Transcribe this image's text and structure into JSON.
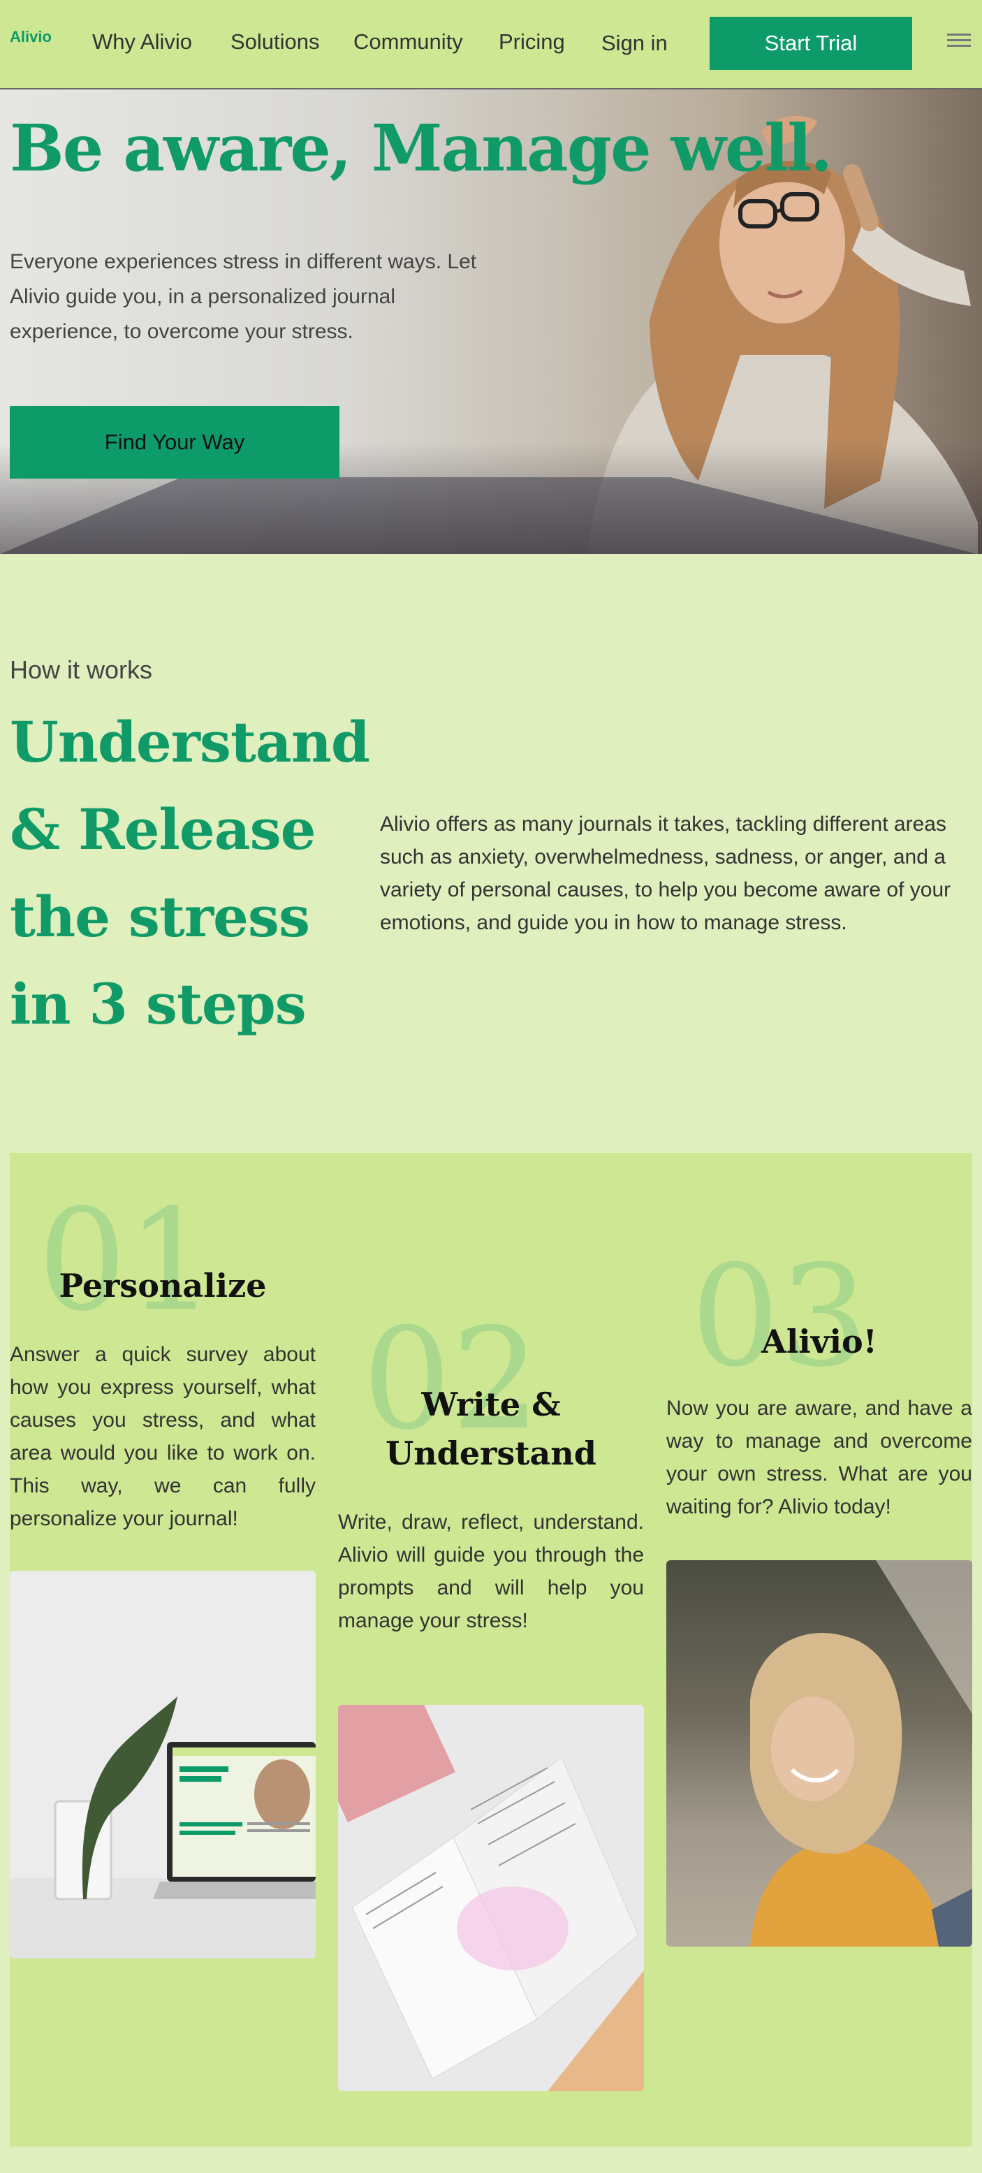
{
  "nav": {
    "logo": "Alivio",
    "links": [
      "Why Alivio",
      "Solutions",
      "Community",
      "Pricing"
    ],
    "sign_in": "Sign in",
    "start_trial": "Start Trial"
  },
  "hero": {
    "title": "Be aware, Manage well.",
    "text": "Everyone experiences stress in different ways. Let Alivio guide you, in a personalized journal experience, to overcome your stress.",
    "cta": "Find Your Way"
  },
  "how": {
    "label": "How it works",
    "title": "Understand & Release the stress in 3 steps",
    "text": "Alivio offers as many journals it takes, tackling different areas such as anxiety, overwhelmedness, sadness, or anger, and a variety of personal causes, to help you become aware of your emotions, and guide you in how to manage stress."
  },
  "steps": [
    {
      "number": "01",
      "title": "Personalize",
      "text": "Answer a quick survey about how you express yourself, what causes you stress, and what area would you like to work on. This way, we can fully personalize your journal!"
    },
    {
      "number": "02",
      "title": "Write & Understand",
      "text": "Write, draw, reflect, understand. Alivio will guide you through the prompts and will help you manage your stress!"
    },
    {
      "number": "03",
      "title": "Alivio!",
      "text": "Now you are aware, and have a way to manage and overcome your own stress. What are you waiting for? Alivio today!"
    }
  ],
  "colors": {
    "accent": "#0e9b6a",
    "nav_bg": "#cde792",
    "page_bg": "#e0efbe"
  }
}
